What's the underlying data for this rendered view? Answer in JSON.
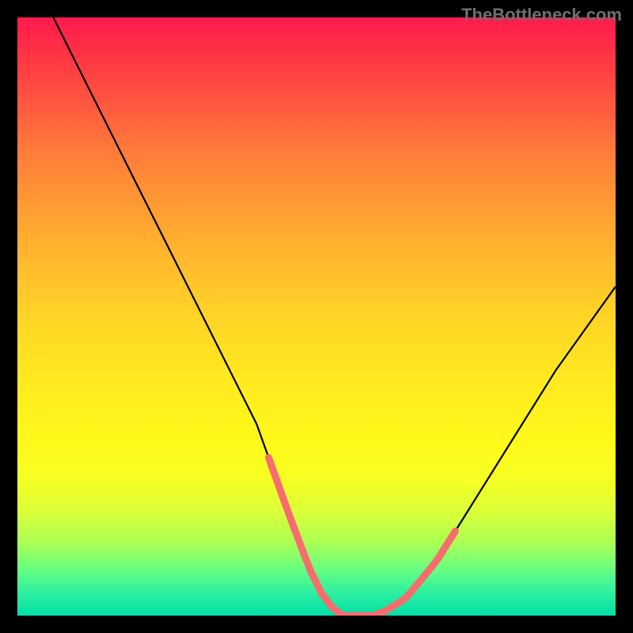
{
  "watermark": "TheBottleneck.com",
  "chart_data": {
    "type": "line",
    "title": "",
    "xlabel": "",
    "ylabel": "",
    "xlim": [
      0,
      100
    ],
    "ylim": [
      0,
      100
    ],
    "series": [
      {
        "name": "bottleneck-curve",
        "x": [
          6,
          10,
          15,
          20,
          25,
          30,
          35,
          40,
          45,
          48,
          50,
          52,
          54,
          56,
          58,
          60,
          62,
          65,
          70,
          75,
          80,
          85,
          90,
          95,
          100
        ],
        "values": [
          100,
          92,
          82,
          72,
          62,
          52,
          42,
          32,
          18,
          10,
          5,
          2,
          0,
          0,
          0,
          0,
          1,
          3,
          9,
          17,
          25,
          33,
          41,
          48,
          55
        ]
      }
    ],
    "highlight_segments": [
      {
        "x_start": 42,
        "x_end": 48,
        "side": "left"
      },
      {
        "x_start": 49,
        "x_end": 63,
        "side": "bottom"
      },
      {
        "x_start": 65,
        "x_end": 72,
        "side": "right"
      }
    ],
    "gradient_stops": [
      {
        "pos": 0,
        "color": "#ff1a4d"
      },
      {
        "pos": 50,
        "color": "#ffd426"
      },
      {
        "pos": 100,
        "color": "#00e0a8"
      }
    ]
  }
}
